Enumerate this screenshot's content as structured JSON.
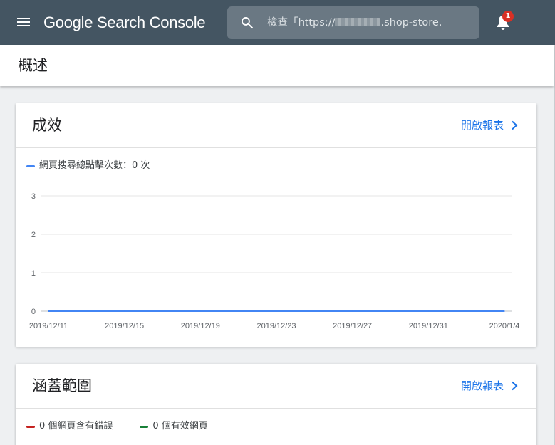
{
  "header": {
    "app_title": "Google Search Console",
    "search_text_prefix": "檢查「https://",
    "search_text_suffix": ".shop-store.",
    "notification_count": "1"
  },
  "page": {
    "title": "概述"
  },
  "performance": {
    "title": "成效",
    "open_report": "開啟報表",
    "legend": "網頁搜尋總點擊次數：0 次",
    "chart_data": {
      "type": "line",
      "x": [
        "2019/12/11",
        "2019/12/15",
        "2019/12/19",
        "2019/12/23",
        "2019/12/27",
        "2019/12/31",
        "2020/1/4"
      ],
      "series": [
        {
          "name": "網頁搜尋總點擊次數",
          "values": [
            0,
            0,
            0,
            0,
            0,
            0,
            0
          ],
          "color": "#4285f4"
        }
      ],
      "y_ticks": [
        0,
        1,
        2,
        3
      ],
      "ylim": [
        0,
        3
      ],
      "grid": true,
      "legend_placement": "top-left"
    }
  },
  "coverage": {
    "title": "涵蓋範圍",
    "open_report": "開啟報表",
    "legend": [
      {
        "label": "0 個網頁含有錯誤",
        "color": "#c5221f"
      },
      {
        "label": "0 個有效網頁",
        "color": "#188038"
      }
    ]
  },
  "colors": {
    "topbar": "#445562",
    "link": "#1a73e8",
    "series": "#4285f4"
  }
}
